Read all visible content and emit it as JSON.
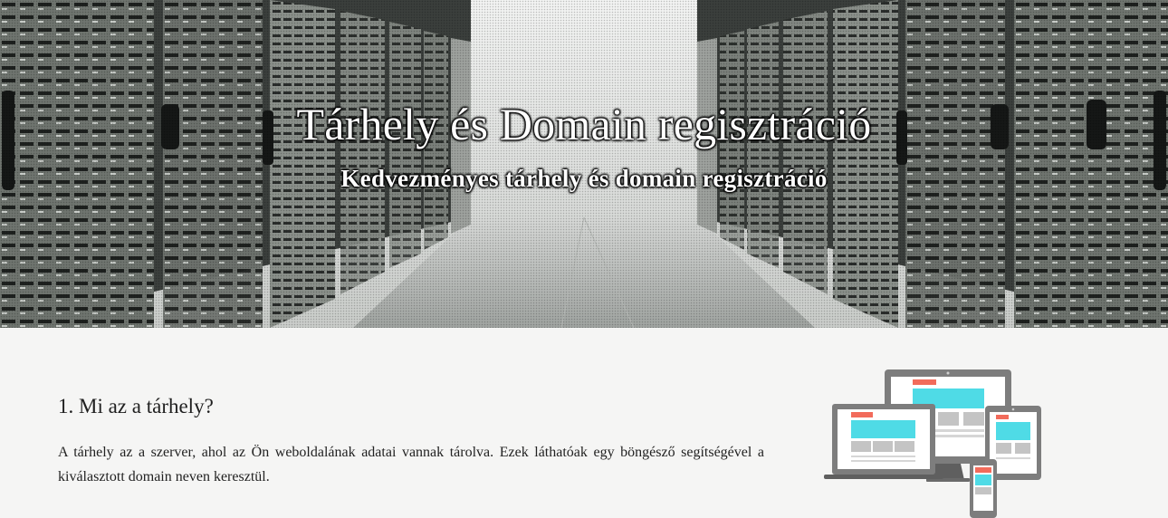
{
  "hero": {
    "title": "Tárhely és Domain regisztráció",
    "subtitle": "Kedvezményes tárhely és domain regisztráció",
    "background": "server-room-image"
  },
  "section": {
    "heading": "1. Mi az a tárhely?",
    "text": "A tárhely az a szerver, ahol az Ön weboldalának adatai vannak tárolva. Ezek láthatóak egy böngésző segítségével a kiválasztott domain neven keresztül."
  },
  "illustration": {
    "name": "responsive-devices-illustration",
    "colors": {
      "frame": "#7d7d7d",
      "accent_red": "#f26b5b",
      "accent_cyan": "#4fdbe6",
      "block": "#c4c4c4"
    }
  },
  "colors": {
    "page_background": "#f5f5f4",
    "text": "#222222",
    "hero_text": "#ffffff"
  }
}
